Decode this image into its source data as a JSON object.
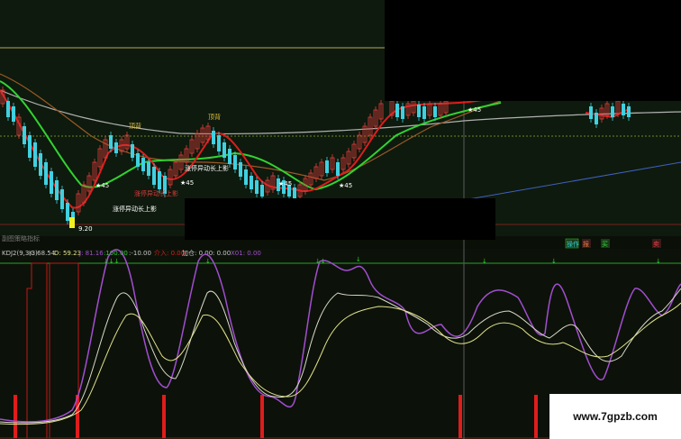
{
  "upper_panel": {
    "annotations": {
      "top_left_1": "顶背",
      "top_left_2": "顶背",
      "star_1": "★45",
      "star_2": "★45",
      "star_3": "★45",
      "star_4": "★45",
      "star_5": "★45",
      "signal_1": "涨停异动长上影",
      "signal_2": "涨停异动长上影",
      "signal_3": "涨停异动长上影",
      "low_price": "9.20"
    },
    "footer_label": "副图策略指标"
  },
  "indicator_bar": {
    "name": "KDJ2(9,3,3)",
    "k": "K: 68.54",
    "d": "D: 59.23",
    "j": "J: 81.16",
    "val1": ":100.00",
    "val2": ":-10.00",
    "val3": "介入: 0.00",
    "val4": "加仓: 0.00",
    "val5": ": 0.00",
    "val6": "X01: 0.00",
    "tags": [
      "操作",
      "报",
      "买",
      "卖"
    ]
  },
  "watermark": "www.7gpzb.com",
  "colors": {
    "background": "#0b1108",
    "red_line": "#e01c1c",
    "green_line": "#32d232",
    "brown_line": "#9a5a28",
    "white_line": "#c8c8c8",
    "purple_line": "#a24ed0",
    "yellow_line": "#e0e08a",
    "candle_up": "#e03c3c",
    "candle_down": "#40d0e0"
  }
}
